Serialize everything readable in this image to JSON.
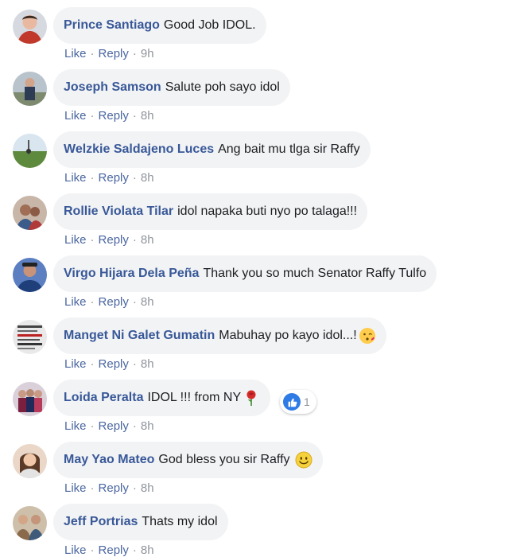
{
  "ui": {
    "action_like": "Like",
    "action_reply": "Reply",
    "separator": "·"
  },
  "comments": [
    {
      "author": "Prince Santiago",
      "text": "Good Job IDOL.",
      "time": "9h",
      "avatar_color": "#c9ced6"
    },
    {
      "author": "Joseph Samson",
      "text": "Salute poh sayo idol",
      "time": "8h",
      "avatar_color": "#9aa8b5"
    },
    {
      "author": "Welzkie Saldajeno Luces",
      "text": "Ang bait mu tlga sir Raffy",
      "time": "8h",
      "avatar_color": "#7fa36a"
    },
    {
      "author": "Rollie Violata Tilar",
      "text": "idol napaka buti nyo po talaga!!!",
      "time": "8h",
      "avatar_color": "#b59888"
    },
    {
      "author": "Virgo Hijara Dela Peña",
      "text": "Thank you so much Senator Raffy Tulfo",
      "time": "8h",
      "avatar_color": "#4d6fa8"
    },
    {
      "author": "Manget Ni Galet Gumatin",
      "text": "Mabuhay po kayo idol...!",
      "time": "8h",
      "avatar_color": "#8b8b8b",
      "emoji": "kissing-face-icon"
    },
    {
      "author": "Loida Peralta",
      "text": "IDOL !!! from NY",
      "time": "8h",
      "avatar_color": "#7a3b52",
      "emoji": "rose-icon",
      "reactions": {
        "icon": "like-reaction-icon",
        "count": "1"
      }
    },
    {
      "author": "May Yao Mateo",
      "text": "God bless you sir Raffy",
      "time": "8h",
      "avatar_color": "#c4a58e",
      "emoji": "smiley-face-icon"
    },
    {
      "author": "Jeff Portrias",
      "text": "Thats my idol",
      "time": "8h",
      "avatar_color": "#9c8a72"
    }
  ]
}
